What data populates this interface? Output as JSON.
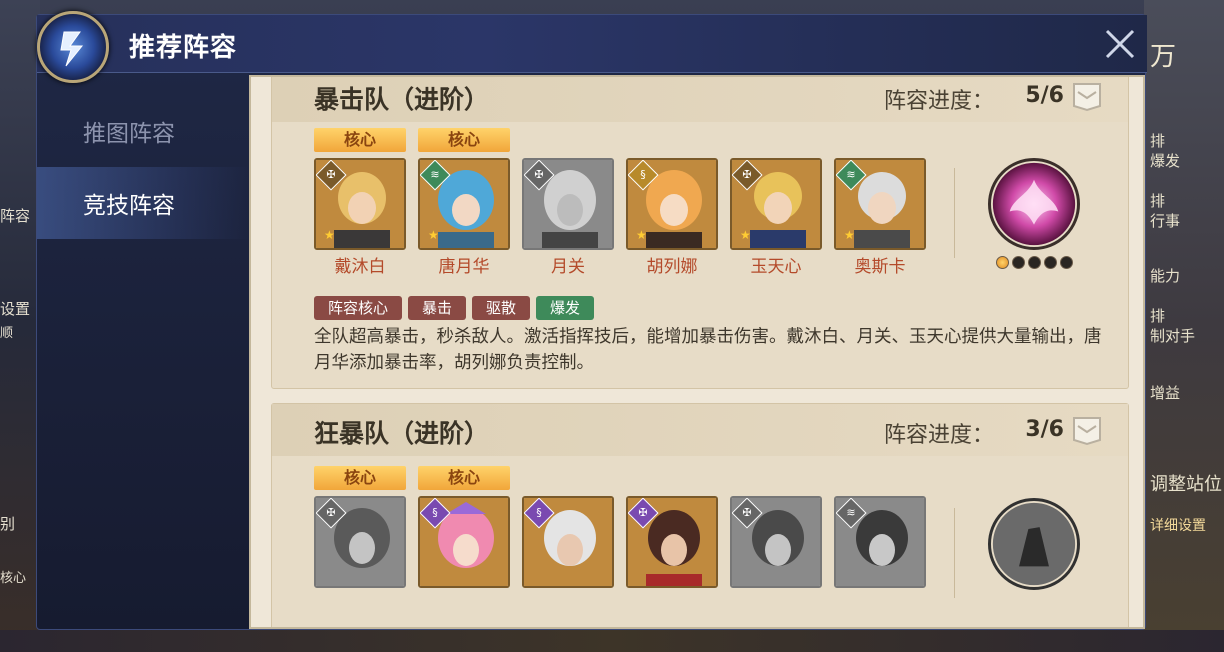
{
  "modal": {
    "title": "推荐阵容"
  },
  "side_menu": [
    {
      "label": "推图阵容",
      "active": false
    },
    {
      "label": "竞技阵容",
      "active": true
    }
  ],
  "background_right": [
    "万",
    "排",
    "爆发",
    "排",
    "行事",
    "能力",
    "排",
    "制对手",
    "增益",
    "调整站位",
    "详细设置"
  ],
  "background_left": [
    "阵容",
    "设置",
    "顺",
    "别",
    "核心"
  ],
  "lineups": [
    {
      "title": "暴击队（进阶）",
      "progress_label": "阵容进度：",
      "progress_value": "5/6",
      "heroes": [
        {
          "name": "戴沐白",
          "core": true,
          "owned": true,
          "badge": "war"
        },
        {
          "name": "唐月华",
          "core": true,
          "owned": true,
          "badge": "wave"
        },
        {
          "name": "月关",
          "core": false,
          "owned": false,
          "badge": "war"
        },
        {
          "name": "胡列娜",
          "core": false,
          "owned": true,
          "badge": "swirl"
        },
        {
          "name": "玉天心",
          "core": false,
          "owned": true,
          "badge": "war"
        },
        {
          "name": "奥斯卡",
          "core": false,
          "owned": true,
          "badge": "wave"
        }
      ],
      "core_tag": "核心",
      "skill_level": 1,
      "skill_max": 5,
      "tags": [
        {
          "label": "阵容核心",
          "color": "brown"
        },
        {
          "label": "暴击",
          "color": "brown"
        },
        {
          "label": "驱散",
          "color": "brown"
        },
        {
          "label": "爆发",
          "color": "green"
        }
      ],
      "description": "全队超高暴击，秒杀敌人。激活指挥技后，能增加暴击伤害。戴沐白、月关、玉天心提供大量输出，唐月华添加暴击率，胡列娜负责控制。"
    },
    {
      "title": "狂暴队（进阶）",
      "progress_label": "阵容进度：",
      "progress_value": "3/6",
      "heroes": [
        {
          "name": "",
          "core": true,
          "owned": false
        },
        {
          "name": "",
          "core": true,
          "owned": true
        },
        {
          "name": "",
          "core": false,
          "owned": true
        },
        {
          "name": "",
          "core": false,
          "owned": true
        },
        {
          "name": "",
          "core": false,
          "owned": false
        },
        {
          "name": "",
          "core": false,
          "owned": false
        }
      ],
      "core_tag": "核心"
    }
  ]
}
